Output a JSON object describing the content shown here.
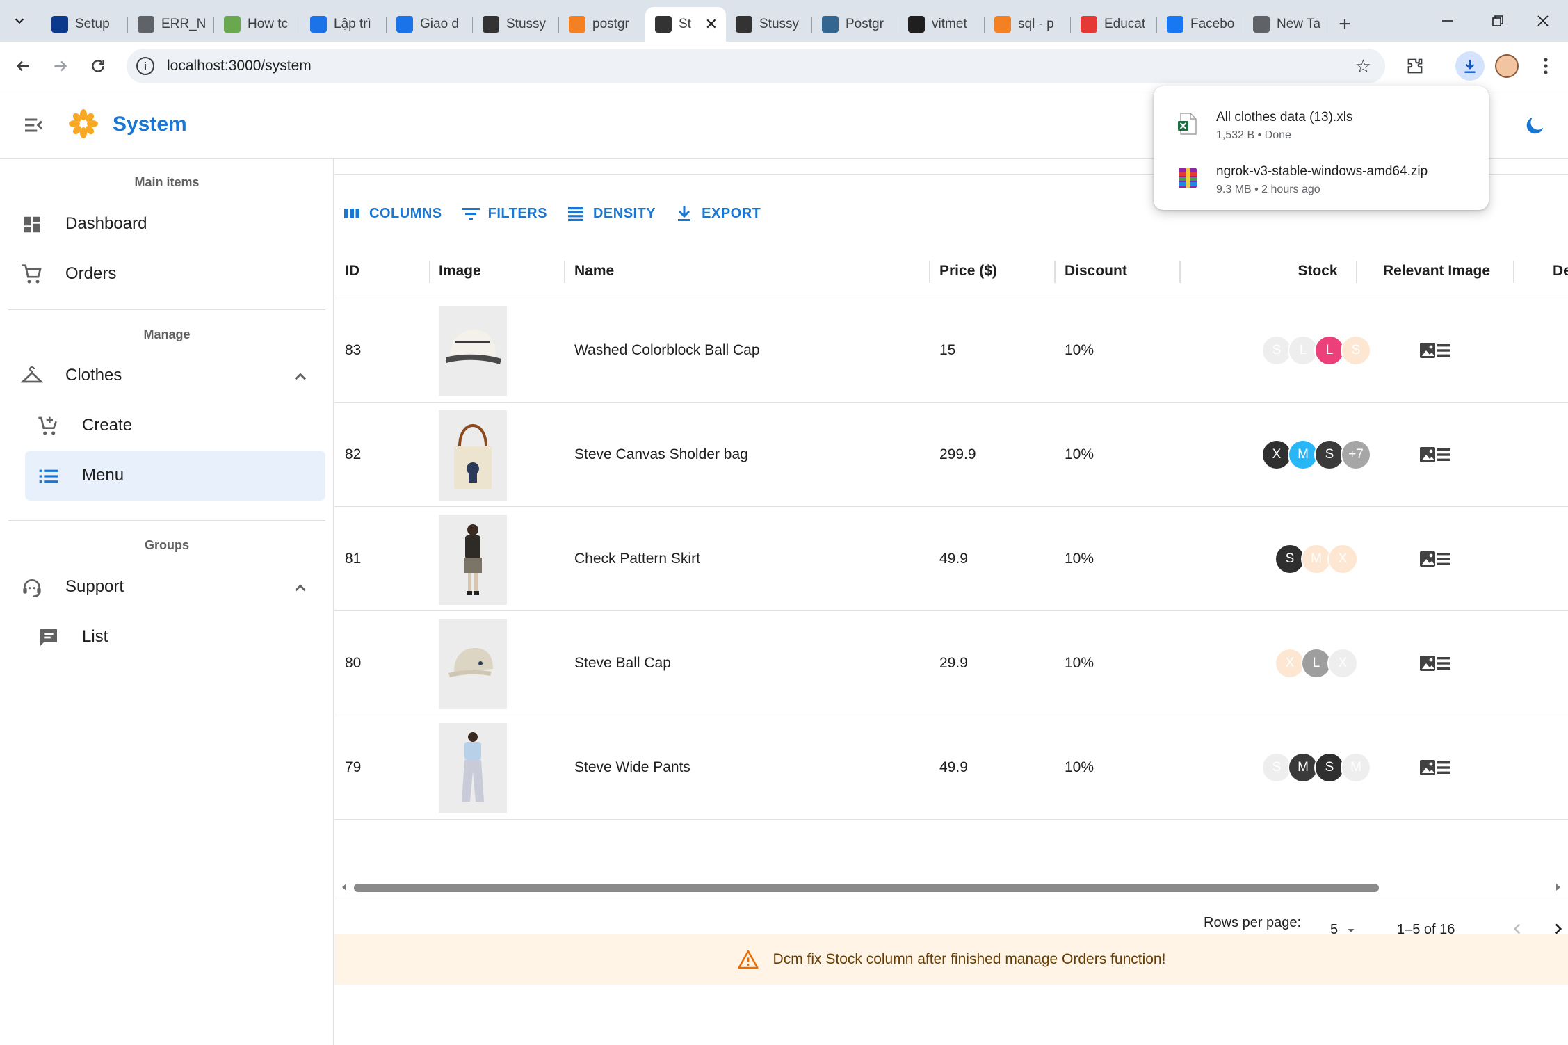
{
  "browser": {
    "tabs": [
      {
        "title": "Setup",
        "icon": "notion-n-icon",
        "color": "#0b3a8c"
      },
      {
        "title": "ERR_N",
        "icon": "globe-icon",
        "color": "#5f6368"
      },
      {
        "title": "How tc",
        "icon": "wp-icon",
        "color": "#6aa84f"
      },
      {
        "title": "Lập trì",
        "icon": "diamond-icon",
        "color": "#1a73e8"
      },
      {
        "title": "Giao d",
        "icon": "diamond-icon",
        "color": "#1a73e8"
      },
      {
        "title": "Stussy",
        "icon": "stussy-icon",
        "color": "#333333"
      },
      {
        "title": "postgr",
        "icon": "stackoverflow-icon",
        "color": "#f48024"
      },
      {
        "title": "St",
        "icon": "stussy-icon",
        "color": "#333333",
        "active": true
      },
      {
        "title": "Stussy",
        "icon": "stussy-icon",
        "color": "#333333"
      },
      {
        "title": "Postgr",
        "icon": "postgres-icon",
        "color": "#336791"
      },
      {
        "title": "vitmet",
        "icon": "github-icon",
        "color": "#1f1f1f"
      },
      {
        "title": "sql - p",
        "icon": "stackoverflow-icon",
        "color": "#f48024"
      },
      {
        "title": "Educat",
        "icon": "educative-icon",
        "color": "#e53935"
      },
      {
        "title": "Facebo",
        "icon": "facebook-icon",
        "color": "#1877f2"
      },
      {
        "title": "New Ta",
        "icon": "chrome-icon",
        "color": "#5f6368"
      }
    ],
    "url": "localhost:3000/system",
    "downloads": [
      {
        "name": "All clothes data (13).xls",
        "meta": "1,532 B • Done",
        "icon": "excel-file-icon"
      },
      {
        "name": "ngrok-v3-stable-windows-amd64.zip",
        "meta": "9.3 MB • 2 hours ago",
        "icon": "zip-archive-icon"
      }
    ]
  },
  "app": {
    "title": "System"
  },
  "sidebar": {
    "groups": [
      {
        "title": "Main items"
      },
      {
        "title": "Manage"
      },
      {
        "title": "Groups"
      }
    ],
    "items": {
      "dashboard": "Dashboard",
      "orders": "Orders",
      "clothes": "Clothes",
      "create": "Create",
      "menu": "Menu",
      "support": "Support",
      "list": "List"
    }
  },
  "grid": {
    "toolbar": {
      "columns": "COLUMNS",
      "filters": "FILTERS",
      "density": "DENSITY",
      "export": "EXPORT"
    },
    "headers": {
      "id": "ID",
      "image": "Image",
      "name": "Name",
      "price": "Price ($)",
      "discount": "Discount",
      "stock": "Stock",
      "relevant_image": "Relevant Image",
      "next": "De"
    },
    "rows": [
      {
        "id": "83",
        "name": "Washed Colorblock Ball Cap",
        "price": "15",
        "discount": "10%",
        "stock": [
          {
            "t": "S",
            "c": "#eeeeee",
            "fg": "#ffffff"
          },
          {
            "t": "L",
            "c": "#eeeeee",
            "fg": "#ffffff"
          },
          {
            "t": "L",
            "c": "#ec407a",
            "fg": "#ffffff"
          },
          {
            "t": "S",
            "c": "#fde7d2",
            "fg": "#ffffff"
          }
        ]
      },
      {
        "id": "82",
        "name": "Steve Canvas Sholder bag",
        "price": "299.9",
        "discount": "10%",
        "stock": [
          {
            "t": "X",
            "c": "#2f2f2f",
            "fg": "#ffffff"
          },
          {
            "t": "M",
            "c": "#29b6f6",
            "fg": "#ffffff"
          },
          {
            "t": "S",
            "c": "#3a3a3a",
            "fg": "#ffffff"
          },
          {
            "t": "+7",
            "c": "#a6a6a6",
            "fg": "#ffffff"
          }
        ]
      },
      {
        "id": "81",
        "name": "Check Pattern Skirt",
        "price": "49.9",
        "discount": "10%",
        "stock": [
          {
            "t": "S",
            "c": "#2f2f2f",
            "fg": "#ffffff"
          },
          {
            "t": "M",
            "c": "#fde7d2",
            "fg": "#ffffff"
          },
          {
            "t": "X",
            "c": "#fde7d2",
            "fg": "#ffffff"
          }
        ]
      },
      {
        "id": "80",
        "name": "Steve Ball Cap",
        "price": "29.9",
        "discount": "10%",
        "stock": [
          {
            "t": "X",
            "c": "#fde7d2",
            "fg": "#ffffff"
          },
          {
            "t": "L",
            "c": "#9e9e9e",
            "fg": "#ffffff"
          },
          {
            "t": "X",
            "c": "#eeeeee",
            "fg": "#ffffff"
          }
        ]
      },
      {
        "id": "79",
        "name": "Steve Wide Pants",
        "price": "49.9",
        "discount": "10%",
        "stock": [
          {
            "t": "S",
            "c": "#eeeeee",
            "fg": "#ffffff"
          },
          {
            "t": "M",
            "c": "#3a3a3a",
            "fg": "#ffffff"
          },
          {
            "t": "S",
            "c": "#2f2f2f",
            "fg": "#ffffff"
          },
          {
            "t": "M",
            "c": "#eeeeee",
            "fg": "#ffffff"
          }
        ]
      }
    ],
    "pagination": {
      "rows_per_page_label": "Rows per page:",
      "rows_per_page": "5",
      "range": "1–5 of 16"
    }
  },
  "alert": {
    "text": "Dcm fix Stock column after finished manage Orders function!"
  },
  "colors": {
    "primary": "#1976d2",
    "selected_bg": "#e8f0fb",
    "warning_bg": "#fff4e5",
    "warning_icon": "#ed6c02"
  }
}
